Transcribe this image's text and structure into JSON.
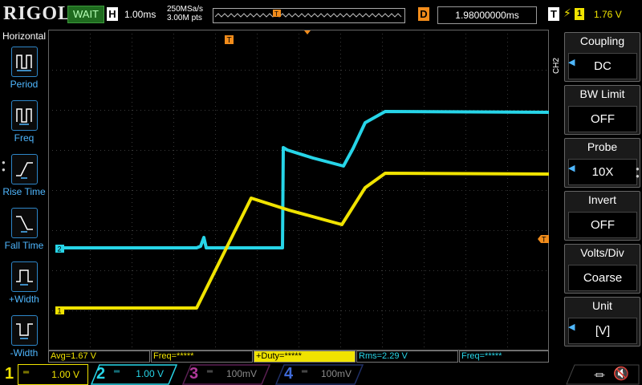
{
  "top": {
    "logo": "RIGOL",
    "status": "WAIT",
    "horizontal_label": "H",
    "timebase": "1.00ms",
    "sample_rate": "250MSa/s",
    "memory_depth": "3.00M pts",
    "trigger_marker": "T",
    "delay_label": "D",
    "delay_value": "1.98000000ms",
    "trigger_label": "T",
    "trigger_source": "1",
    "trigger_level": "1.76 V"
  },
  "left_panel": {
    "title": "Horizontal",
    "items": [
      {
        "label": "Period",
        "icon": "period-icon"
      },
      {
        "label": "Freq",
        "icon": "freq-icon"
      },
      {
        "label": "Rise Time",
        "icon": "rise-time-icon"
      },
      {
        "label": "Fall Time",
        "icon": "fall-time-icon"
      },
      {
        "label": "+Width",
        "icon": "pos-width-icon"
      },
      {
        "label": "-Width",
        "icon": "neg-width-icon"
      }
    ]
  },
  "right_panel": {
    "channel": "CH2",
    "menus": [
      {
        "title": "Coupling",
        "value": "DC"
      },
      {
        "title": "BW Limit",
        "value": "OFF"
      },
      {
        "title": "Probe",
        "value": "10X"
      },
      {
        "title": "Invert",
        "value": "OFF"
      },
      {
        "title": "Volts/Div",
        "value": "Coarse"
      },
      {
        "title": "Unit",
        "value": "[V]"
      }
    ]
  },
  "measurements": [
    {
      "text": "Avg=1.67 V",
      "color": "#f0e300"
    },
    {
      "text": "Freq=*****",
      "color": "#f0e300"
    },
    {
      "text": "+Duty=*****",
      "color": "#f0e300"
    },
    {
      "text": "Rms=2.29 V",
      "color": "#27d5e8"
    },
    {
      "text": "Freq=*****",
      "color": "#27d5e8"
    }
  ],
  "channels": [
    {
      "num": "1",
      "scale": "1.00 V",
      "color": "#f0e300",
      "active": true
    },
    {
      "num": "2",
      "scale": "1.00 V",
      "color": "#27d5e8",
      "active": true
    },
    {
      "num": "3",
      "scale": "100mV",
      "color": "#b0399a",
      "active": false
    },
    {
      "num": "4",
      "scale": "100mV",
      "color": "#3f6ad8",
      "active": false
    }
  ],
  "markers": {
    "ch1": "1",
    "ch2": "2",
    "trigger_level": "T",
    "trigger_pos": "T"
  },
  "colors": {
    "ch1": "#f0e300",
    "ch2": "#27d5e8",
    "trigger": "#f28c1b",
    "accent": "#2e86c8"
  }
}
